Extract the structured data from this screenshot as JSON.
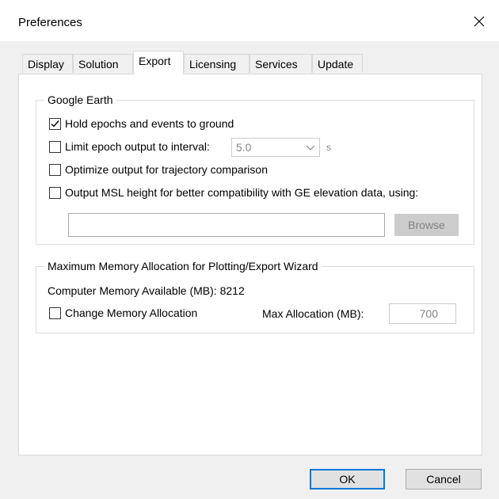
{
  "window": {
    "title": "Preferences",
    "close_icon": "close-icon"
  },
  "tabs": [
    {
      "label": "Display",
      "active": false
    },
    {
      "label": "Solution",
      "active": false
    },
    {
      "label": "Export",
      "active": true
    },
    {
      "label": "Licensing",
      "active": false
    },
    {
      "label": "Services",
      "active": false
    },
    {
      "label": "Update",
      "active": false
    }
  ],
  "google_earth": {
    "legend": "Google Earth",
    "hold_epochs": {
      "label": "Hold epochs and events to ground",
      "checked": true
    },
    "limit_epoch": {
      "label": "Limit epoch output to interval:",
      "checked": false,
      "value": "5.0",
      "unit": "s"
    },
    "optimize": {
      "label": "Optimize output for trajectory comparison",
      "checked": false
    },
    "output_msl": {
      "label": "Output MSL height for better compatibility with GE elevation data, using:",
      "checked": false
    },
    "path_value": "",
    "browse_label": "Browse"
  },
  "memory": {
    "legend": "Maximum Memory Allocation for Plotting/Export Wizard",
    "available_text": "Computer Memory Available (MB): 8212",
    "change_alloc": {
      "label": "Change Memory Allocation",
      "checked": false
    },
    "max_alloc_label": "Max Allocation (MB):",
    "max_alloc_value": "700"
  },
  "footer": {
    "ok_label": "OK",
    "cancel_label": "Cancel"
  },
  "colors": {
    "accent": "#0078d7",
    "disabled_text": "#838383",
    "panel_bg": "#ffffff",
    "dialog_bg": "#f0f0f0"
  }
}
